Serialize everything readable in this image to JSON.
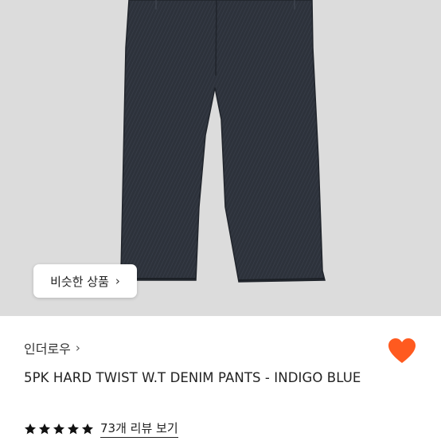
{
  "similar_products_label": "비슷한 상품",
  "chevron_glyph": "›",
  "brand_name": "인더로우",
  "product_title": "5PK HARD TWIST W.T DENIM PANTS - INDIGO BLUE",
  "rating": {
    "stars_filled": 5,
    "stars_total": 5
  },
  "reviews_link": "73개 리뷰 보기",
  "colors": {
    "heart": "#ff5a1f",
    "star": "#111111",
    "background": "#dcdcdc",
    "denim": "#2c313a"
  },
  "icons": [
    "chevron-right-icon",
    "heart-icon",
    "star-icon"
  ]
}
